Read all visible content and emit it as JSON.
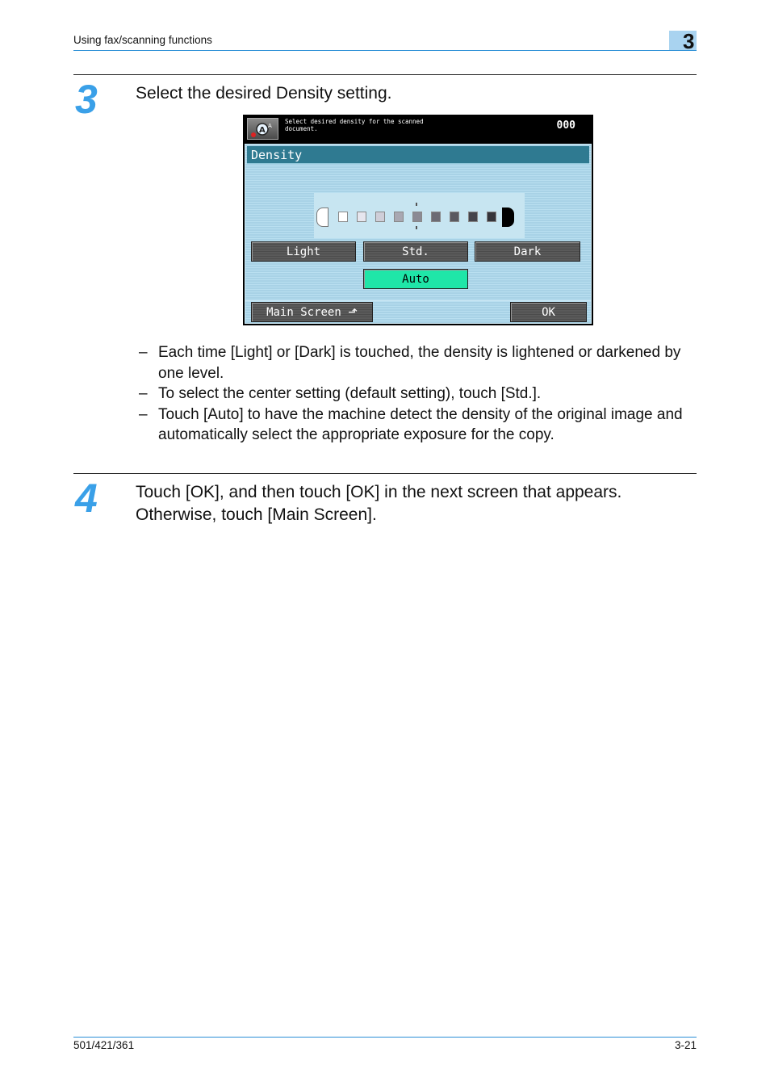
{
  "header": {
    "section_title": "Using fax/scanning functions",
    "chapter_number": "3"
  },
  "steps": [
    {
      "number": "3",
      "text": "Select the desired Density setting.",
      "bullets": [
        "Each time [Light] or [Dark] is touched, the density is lightened or darkened by one level.",
        "To select the center setting (default setting), touch [Std.].",
        "Touch [Auto] to have the machine detect the density of the original image and automatically select the appropriate exposure for the copy."
      ]
    },
    {
      "number": "4",
      "text": "Touch [OK], and then touch [OK] in the next screen that appears. Otherwise, touch [Main Screen]."
    }
  ],
  "device_screen": {
    "message": "Select desired density for the scanned document.",
    "counter": "000",
    "mode_icon": "scan-mode-icon",
    "title": "Density",
    "density_scale": {
      "levels": 9,
      "selected_level": 5,
      "swatch_colors": [
        "#ffffff",
        "#e6e6ee",
        "#cfced8",
        "#a9a8b2",
        "#8b8a94",
        "#6c6b74",
        "#5a5960",
        "#45444b",
        "#35343a"
      ]
    },
    "buttons": {
      "light": "Light",
      "std": "Std.",
      "dark": "Dark",
      "auto": "Auto",
      "main_screen": "Main Screen",
      "ok": "OK"
    },
    "active_button": "auto",
    "colors": {
      "title_bar": "#2f7a91",
      "auto_active": "#1fe6a8",
      "panel": "#b9dff0"
    }
  },
  "footer": {
    "model": "501/421/361",
    "page": "3-21"
  }
}
